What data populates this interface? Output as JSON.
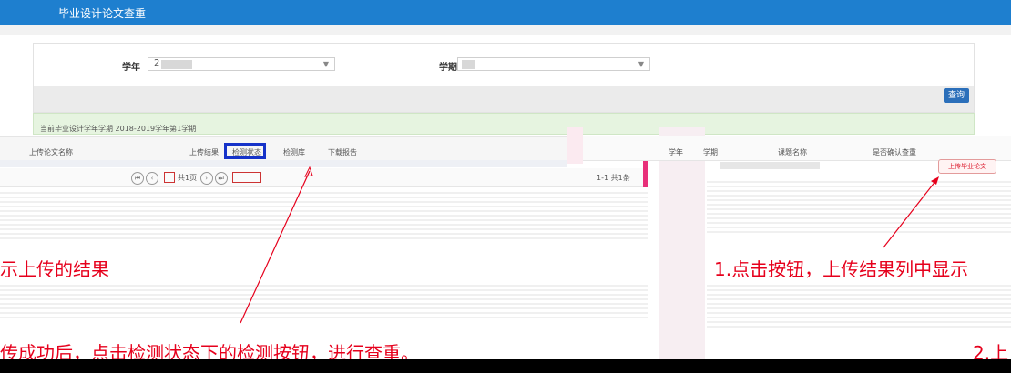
{
  "header": {
    "title": "毕业设计论文查重"
  },
  "filters": {
    "year_label": "学年",
    "year_value": "2",
    "term_label": "学期",
    "query_label": "查询"
  },
  "info": {
    "text": "当前毕业设计学年学期 2018-2019学年第1学期"
  },
  "left_grid": {
    "columns": [
      "上传论文名称",
      "上传结果",
      "检测状态",
      "检测库",
      "下载报告"
    ]
  },
  "pager": {
    "page_text": "共1页",
    "summary": "1-1  共1条"
  },
  "right_grid": {
    "columns": [
      "学年",
      "学期",
      "课题名称",
      "是否确认查重"
    ],
    "action_label": "上传毕业论文"
  },
  "notes": {
    "left_top": "示上传的结果",
    "left_bottom": "传成功后，点击检测状态下的检测按钮，进行查重。",
    "right_top": "1.点击按钮，上传结果列中显示",
    "right_bottom": "2.上"
  },
  "colors": {
    "header_bg": "#1e7fcf",
    "annotation": "#e6001c",
    "highlight_box": "#1633c9"
  }
}
